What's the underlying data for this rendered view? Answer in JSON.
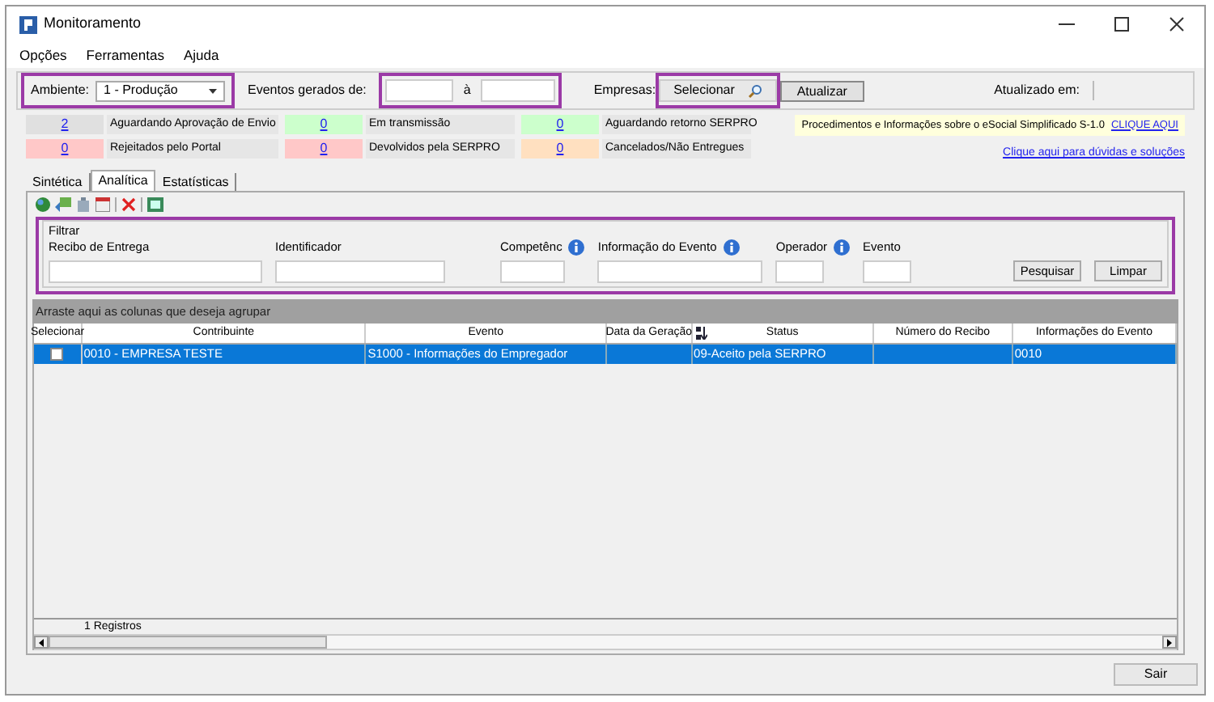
{
  "window": {
    "title": "Monitoramento"
  },
  "menu": [
    "Opções",
    "Ferramentas",
    "Ajuda"
  ],
  "toolbar": {
    "ambiente_label": "Ambiente:",
    "ambiente_value": "1 - Produção",
    "eventos_label": "Eventos gerados de:",
    "ate_label": "à",
    "empresas_label": "Empresas:",
    "selecionar": "Selecionar",
    "atualizar": "Atualizar",
    "atualizado_label": "Atualizado em:"
  },
  "counters": [
    [
      {
        "count": "2",
        "label": "Aguardando Aprovação de Envio",
        "color": "#e0e0e0"
      },
      {
        "count": "0",
        "label": "Em transmissão",
        "color": "#ccffcc"
      },
      {
        "count": "0",
        "label": "Aguardando retorno SERPRO",
        "color": "#ccffcc"
      }
    ],
    [
      {
        "count": "0",
        "label": "Rejeitados pelo Portal",
        "color": "#ffc8c8"
      },
      {
        "count": "0",
        "label": "Devolvidos pela SERPRO",
        "color": "#ffc8c8"
      },
      {
        "count": "0",
        "label": "Cancelados/Não Entregues",
        "color": "#ffe0c0"
      }
    ]
  ],
  "notice": {
    "text": "Procedimentos e Informações sobre o eSocial Simplificado S-1.0",
    "link": "CLIQUE AQUI"
  },
  "help_link": "Clique aqui para dúvidas e soluções",
  "tabs": [
    {
      "label": "Sintética",
      "selected": false
    },
    {
      "label": "Analítica",
      "selected": true
    },
    {
      "label": "Estatísticas",
      "selected": false
    }
  ],
  "filter": {
    "legend": "Filtrar",
    "fields": [
      {
        "label": "Recibo de Entrega",
        "info": false
      },
      {
        "label": "Identificador",
        "info": false
      },
      {
        "label": "Competênc",
        "info": true
      },
      {
        "label": "Informação do Evento",
        "info": true
      },
      {
        "label": "Operador",
        "info": true
      },
      {
        "label": "Evento",
        "info": false
      }
    ],
    "buttons": [
      "Pesquisar",
      "Limpar"
    ]
  },
  "group_hint": "Arraste aqui as colunas que deseja agrupar",
  "table": {
    "columns": [
      {
        "label": "Selecionar",
        "sorted": false
      },
      {
        "label": "Contribuinte",
        "sorted": false
      },
      {
        "label": "Evento",
        "sorted": false
      },
      {
        "label": "Data da Geração",
        "sorted": false
      },
      {
        "label": "Status",
        "sorted": true
      },
      {
        "label": "Número do Recibo",
        "sorted": false
      },
      {
        "label": "Informações do Evento",
        "sorted": false
      }
    ],
    "rows": [
      {
        "selected": true,
        "checked": false,
        "cells": [
          "",
          "0010 - EMPRESA TESTE",
          "S1000 - Informações do Empregador",
          "",
          "09-Aceito pela SERPRO",
          "",
          "0010"
        ]
      }
    ],
    "footer": "1 Registros"
  },
  "exit_button": "Sair"
}
